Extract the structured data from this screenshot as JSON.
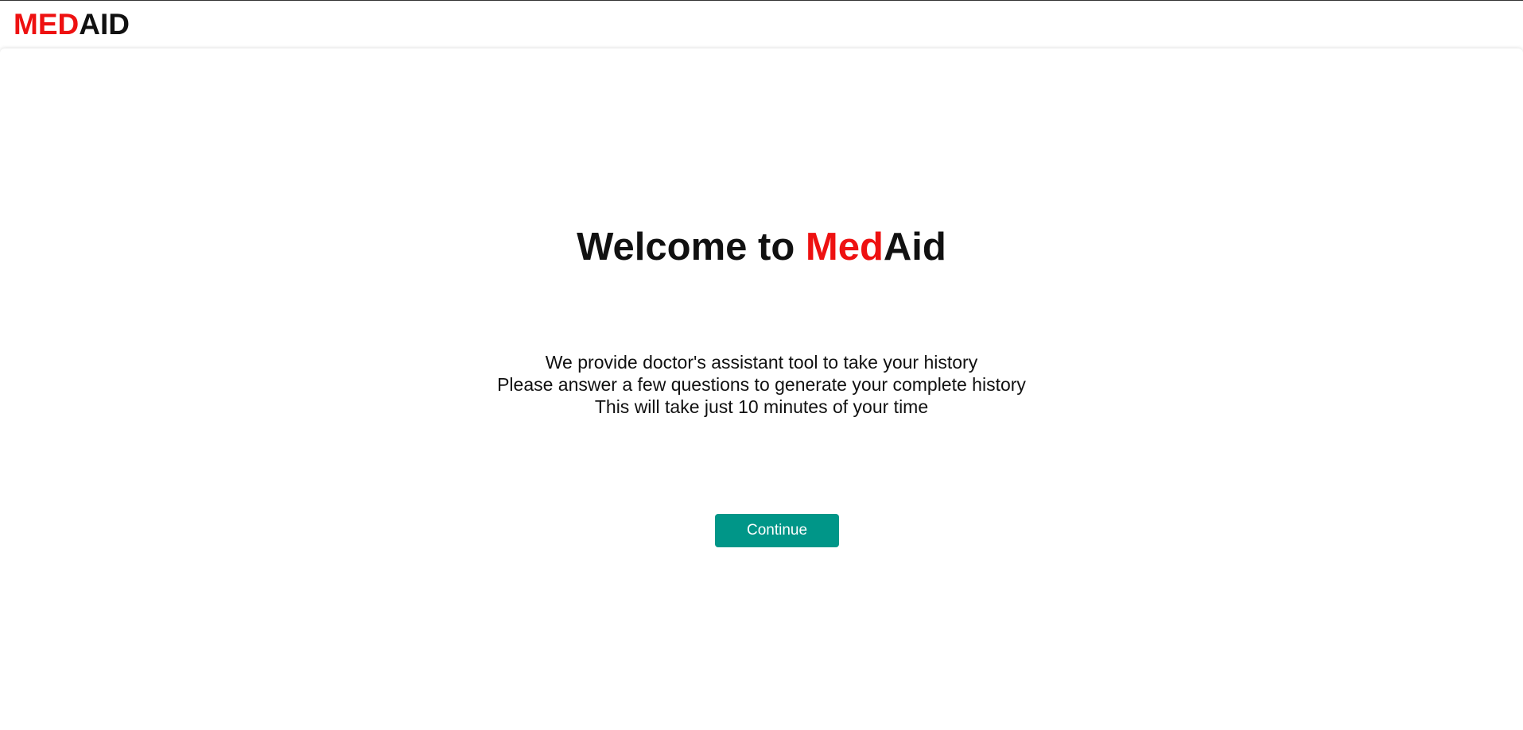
{
  "header": {
    "logo_part1": "MED",
    "logo_part2": "AID"
  },
  "main": {
    "welcome_prefix": "Welcome to ",
    "welcome_brand_red": "Med",
    "welcome_brand_dark": "Aid",
    "description_lines": [
      "We provide doctor's assistant tool to take your history",
      "Please answer a few questions to generate your complete history",
      "This will take just 10 minutes of your time"
    ],
    "continue_label": "Continue"
  },
  "colors": {
    "brand_red": "#ee1111",
    "text_dark": "#111111",
    "button_teal": "#009688",
    "button_text": "#ffffff"
  }
}
